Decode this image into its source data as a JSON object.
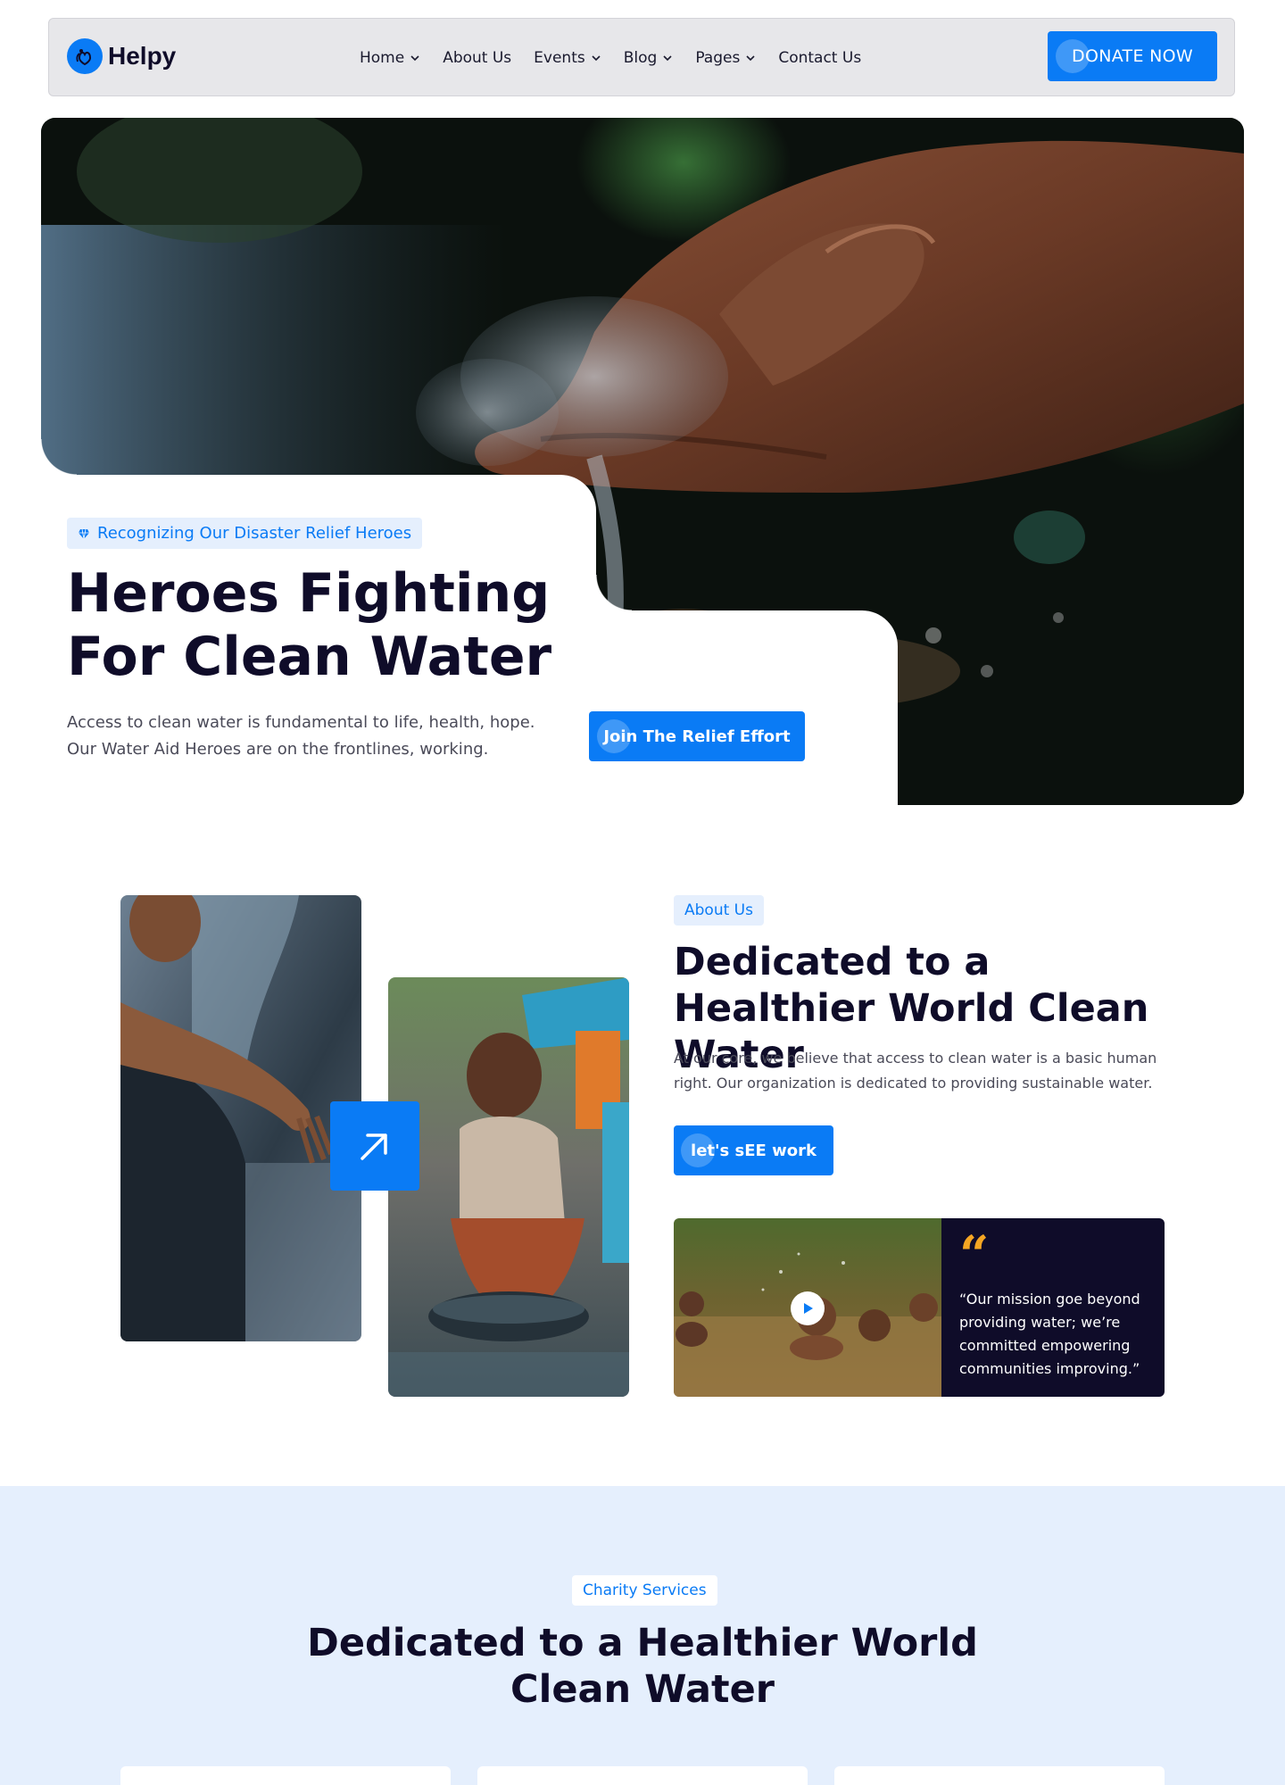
{
  "nav": {
    "brand": "Helpy",
    "menu": [
      {
        "label": "Home",
        "has_dropdown": true
      },
      {
        "label": "About Us",
        "has_dropdown": false
      },
      {
        "label": "Events",
        "has_dropdown": true
      },
      {
        "label": "Blog",
        "has_dropdown": true
      },
      {
        "label": "Pages",
        "has_dropdown": true
      },
      {
        "label": "Contact Us",
        "has_dropdown": false
      }
    ],
    "donate_label": "DONATE NOW"
  },
  "hero": {
    "tagline": "Recognizing Our Disaster Relief Heroes",
    "title": "Heroes Fighting For Clean Water",
    "description": "Access to clean water is fundamental to life, health, hope. Our Water Aid Heroes are on the frontlines, working.",
    "cta_label": "Join The Relief Effort"
  },
  "about": {
    "chip": "About Us",
    "title": "Dedicated to a Healthier World Clean Water",
    "description": "At our core, we believe that access to clean water is a basic human right. Our organization is dedicated to providing sustainable water.",
    "cta_label": "let's sEE work",
    "quote": "“Our mission goe beyond providing water; we’re committed empowering communities improving.”",
    "quote_mark": "“"
  },
  "services": {
    "chip": "Charity Services",
    "title": "Dedicated to a Healthier World Clean Water"
  },
  "colors": {
    "accent": "#0a7bf5",
    "dark": "#0f0c29",
    "quote_accent": "#f5a623",
    "soft_bg": "#e5effd"
  },
  "icons": [
    "logo-mark-icon",
    "chevron-down-icon",
    "heart-diamond-icon",
    "arrow-up-right-icon",
    "play-icon",
    "quote-icon"
  ]
}
